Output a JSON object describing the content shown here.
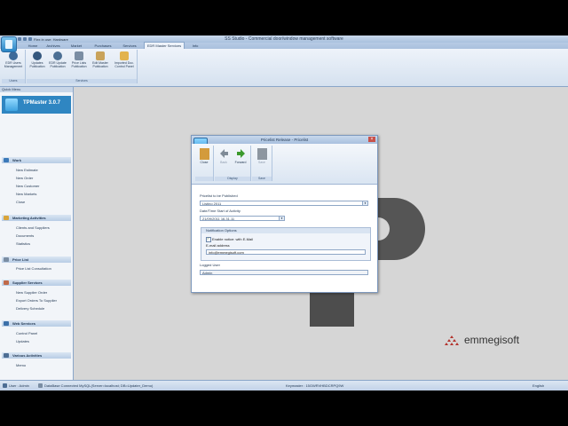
{
  "window": {
    "title": "SS Studio - Commercial door/window management software",
    "qat_label": "Flex in use: Hardware"
  },
  "ribbon_tabs": [
    "Home",
    "Archives",
    "Market",
    "Purchases",
    "Services",
    "EDR Master Services",
    "Info"
  ],
  "ribbon": {
    "groups": [
      {
        "label": "Users",
        "buttons": [
          "EDR Users Management"
        ]
      },
      {
        "label": "Services",
        "buttons": [
          "Updates Publication",
          "EDR Update Publication",
          "Price Lists Publication",
          "Edit Master Publication",
          "Imported Doc. Control Panel"
        ]
      }
    ]
  },
  "sidebar": {
    "header": "Quick Menu",
    "logo_text": "TPMaster 3.0.7",
    "sections": [
      {
        "title": "Work",
        "items": [
          "New Estimate",
          "New Order",
          "New Customer",
          "New Markets",
          "Close"
        ]
      },
      {
        "title": "Marketing Activities",
        "items": [
          "Clients and Suppliers",
          "Documents",
          "Statistics"
        ]
      },
      {
        "title": "Price List",
        "items": [
          "Price List Consultation"
        ]
      },
      {
        "title": "Supplier Services",
        "items": [
          "New Supplier Order",
          "Export Orders To Supplier",
          "Delivery Schedule"
        ]
      },
      {
        "title": "Web Services",
        "items": [
          "Control Panel",
          "Updates"
        ]
      },
      {
        "title": "Various Activities",
        "items": [
          "Memo"
        ]
      }
    ]
  },
  "dialog": {
    "title": "Pricelist Release - Pricelist",
    "groups": [
      {
        "label": "",
        "buttons": [
          {
            "label": "Close",
            "icon": "door-icon"
          }
        ]
      },
      {
        "label": "Display",
        "buttons": [
          {
            "label": "Back",
            "icon": "arrow-left-icon"
          },
          {
            "label": "Forward",
            "icon": "arrow-right-icon"
          }
        ]
      },
      {
        "label": "Save",
        "buttons": [
          {
            "label": "Save",
            "icon": "floppy-icon"
          }
        ]
      }
    ],
    "fields": {
      "pricelist_label": "Pricelist to be Published",
      "pricelist_value": "Listino 2011",
      "date_label": "Date/Time Start of Activity",
      "date_value": "21/09/2011 16.31.11",
      "notification_title": "Notification Options",
      "checkbox_label": "Enable notice: with E-Mail",
      "email_label": "E-mail address",
      "email_value": "info@emmegisoft.com",
      "user_label": "Logged User",
      "user_value": "Admin"
    }
  },
  "brand": {
    "name": "emmegisoft"
  },
  "status_bar": {
    "user": "User : Admin",
    "db": "DataBase Connected MySQL(Server=localhost; DB=Updater_Demo)",
    "keymaster": "Keymaster : 15GWRVHBDCRPQ9W",
    "language": "English"
  },
  "colors": {
    "accent": "#2f86c2",
    "ribbon": "#d5e1ef",
    "background": "#d6d6d6"
  }
}
